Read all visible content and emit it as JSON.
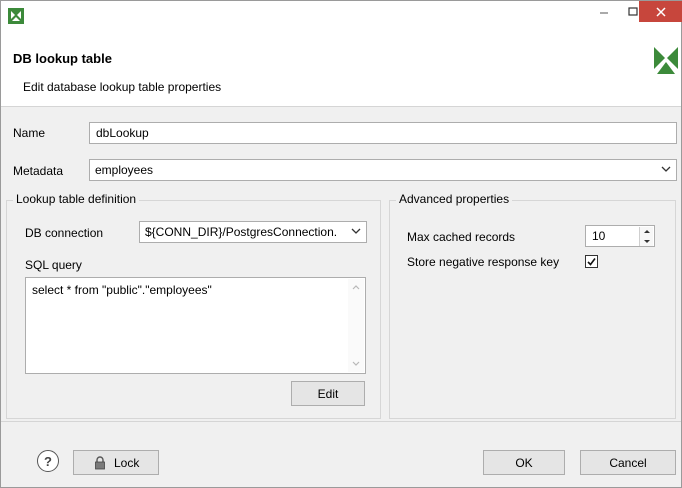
{
  "dialog": {
    "title": "DB lookup table",
    "subtitle": "Edit database lookup table properties"
  },
  "form": {
    "name_label": "Name",
    "name_value": "dbLookup",
    "metadata_label": "Metadata",
    "metadata_value": "employees"
  },
  "lookup_group": {
    "title": "Lookup table definition",
    "db_connection_label": "DB connection",
    "db_connection_value": "${CONN_DIR}/PostgresConnection.",
    "sql_query_label": "SQL query",
    "sql_query_value": "select * from \"public\".\"employees\"",
    "edit_button": "Edit"
  },
  "advanced_group": {
    "title": "Advanced properties",
    "max_cached_label": "Max cached records",
    "max_cached_value": "10",
    "store_negative_label": "Store negative response key",
    "store_negative_checked": true
  },
  "footer": {
    "help_glyph": "?",
    "lock_label": "Lock",
    "ok_label": "OK",
    "cancel_label": "Cancel"
  },
  "icons": {
    "app": "cloverdx-icon",
    "logo": "cloverdx-logo-icon",
    "minimize": "minimize-icon",
    "maximize": "maximize-icon",
    "close": "close-icon",
    "dropdown": "chevron-down-icon",
    "help": "help-icon",
    "lock": "lock-icon"
  },
  "colors": {
    "close_button": "#c7463c",
    "brand_green": "#3c8a3a",
    "dialog_bg": "#f0f0f0"
  }
}
